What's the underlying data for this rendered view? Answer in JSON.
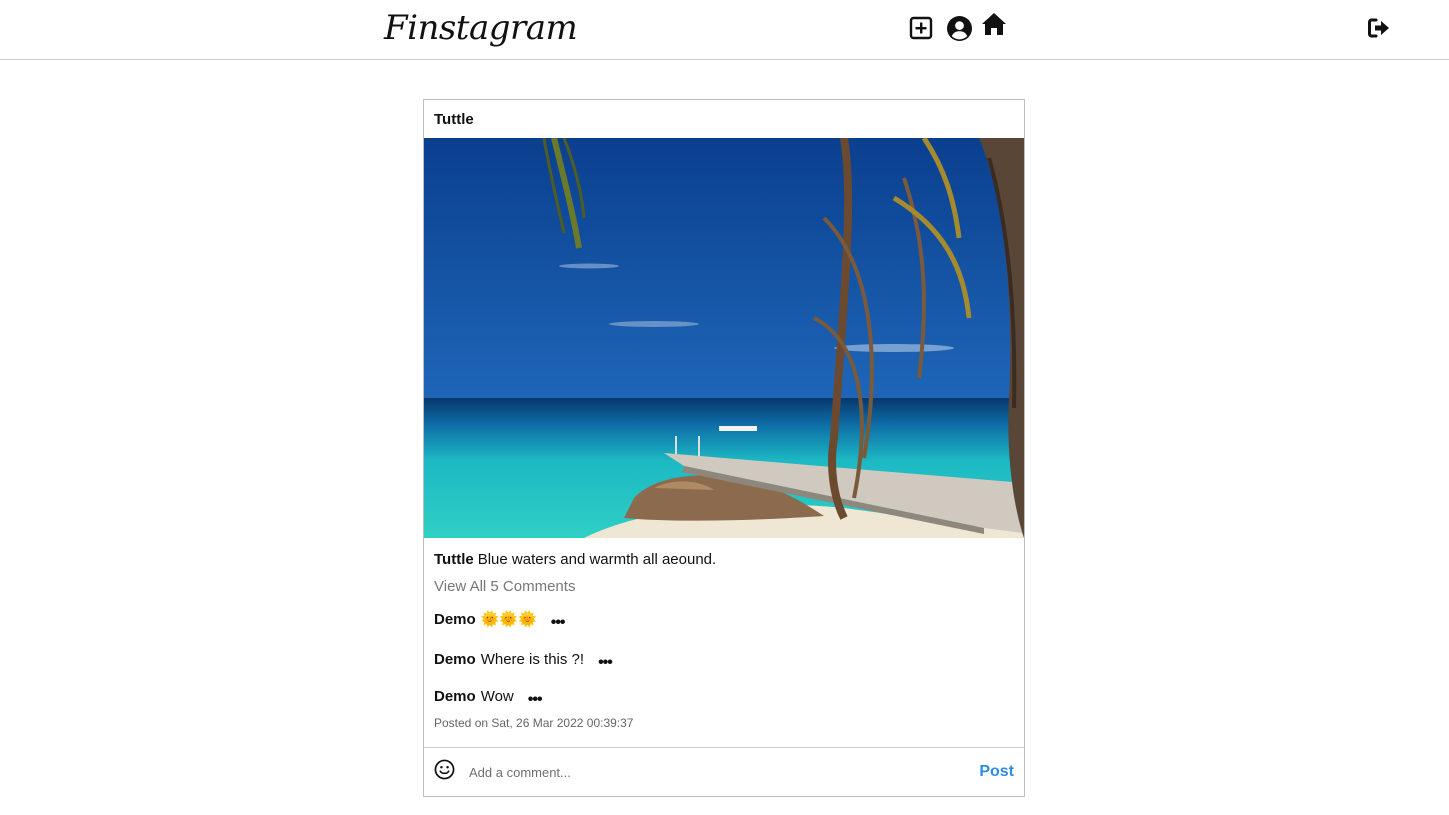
{
  "nav": {
    "logo": "Finstagram",
    "icons": [
      "add-post-icon",
      "profile-icon",
      "home-icon",
      "logout-icon"
    ]
  },
  "post": {
    "author": "Tuttle",
    "caption_user": "Tuttle",
    "caption": "Blue waters and warmth all aeound.",
    "view_all": "View All 5 Comments",
    "comments": [
      {
        "user": "Demo",
        "text": "🌞🌞🌞",
        "more": "•••"
      },
      {
        "user": "Demo",
        "text": "Where is this ?!",
        "more": "•••"
      },
      {
        "user": "Demo",
        "text": "Wow",
        "more": "•••"
      }
    ],
    "timestamp": "Posted on Sat, 26 Mar 2022 00:39:37"
  },
  "comment_box": {
    "placeholder": "Add a comment...",
    "value": "",
    "post_label": "Post"
  },
  "colors": {
    "post_button": "#2f8de4",
    "border": "#bdbdbd"
  }
}
